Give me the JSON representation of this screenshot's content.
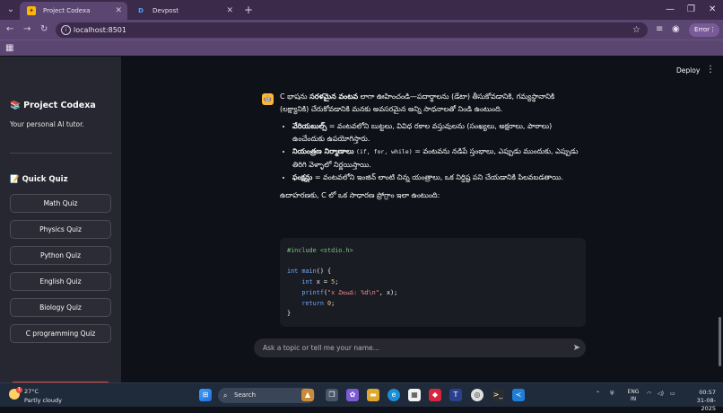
{
  "browser": {
    "tabs": [
      {
        "title": "Project Codexa",
        "active": true
      },
      {
        "title": "Devpost",
        "active": false
      }
    ],
    "url": "localhost:8501",
    "profile_label": "Error"
  },
  "sidebar": {
    "title": "Project Codexa",
    "subtitle": "Your personal AI tutor.",
    "quiz_heading": "Quick Quiz",
    "quiz_buttons": [
      "Math Quiz",
      "Physics Quiz",
      "Python Quiz",
      "English Quiz",
      "Biology Quiz",
      "C programming Quiz"
    ]
  },
  "header": {
    "deploy_label": "Deploy"
  },
  "chat": {
    "intro_part1": "C భాషను ",
    "intro_bold": "సరళమైన వంటవ",
    "intro_part2": " లాగా ఊహించండి—పదార్థాలను (డేటా) తీసుకోవడానికి, గమ్యస్థానానికి (లక్ష్యానికి) చేరుకోవడానికి మనకు అవసరమైన అన్ని సాధనాలతో నిండి ఉంటుంది.",
    "bullets": [
      {
        "bold": "వేరియబుల్స్",
        "code": "",
        "text": " = వంటవలోని బుట్టలు, వివిధ రకాల వస్తువులను (సంఖ్యలు, అక్షరాలు, పాఠాలు) ఉంచేందుకు ఉపయోగిస్తారు."
      },
      {
        "bold": "నియంత్రణ నిర్మాణాలు",
        "code": "(if, for, while)",
        "text": " = వంటవను నడిపే స్తంభాలు, ఎప్పుడు ముందుకు, ఎప్పుడు తిరిగి వెళ్ళాలో నిర్ణయిస్తాయి."
      },
      {
        "bold": "ఫంక్షన్లు",
        "code": "",
        "text": " = వంటవలోని ఇంజిన్ లాంటి చిన్న యంత్రాలు, ఒక నిర్దిష్ట పని చేయడానికి పిలవబడతాయి."
      }
    ],
    "example_intro": "ఉదాహరణకు, C లో ఒక సాధారణ ప్రోగ్రాం ఇలా ఉంటుంది:",
    "code": {
      "include": "#include <stdio.h>",
      "kw_int": "int",
      "fn_main": "main",
      "main_rest": "() {",
      "var_line_mid": " x = ",
      "var_value": "5",
      "semicolon": ";",
      "printf": "printf",
      "printf_str": "\"x విలువ: %d\\n\"",
      "printf_rest": ", x);",
      "return_kw": "return",
      "return_val": "0",
      "close": "}"
    },
    "input_placeholder": "Ask a topic or tell me your name..."
  },
  "taskbar": {
    "temperature": "27°C",
    "weather": "Partly cloudy",
    "weather_badge": "1",
    "search_label": "Search",
    "lang_line1": "ENG",
    "lang_line2": "IN",
    "time": "00:57",
    "date": "31-08-2025"
  }
}
